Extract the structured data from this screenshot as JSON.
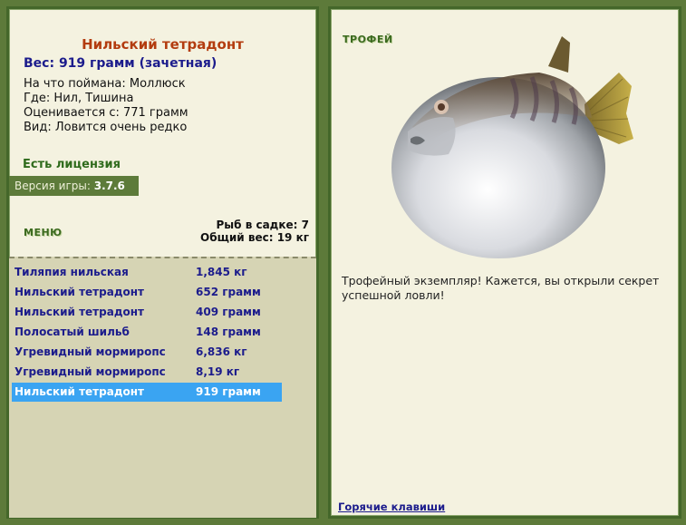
{
  "fish": {
    "title": "Нильский тетрадонт",
    "weight_line": "Вес: 919 грамм (зачетная)",
    "bait": "На что поймана: Моллюск",
    "location": "Где: Нил, Тишина",
    "value": "Оценивается с: 771 грамм",
    "species": "Вид: Ловится очень редко"
  },
  "license": "Есть лицензия",
  "version": {
    "label": "Версия игры:",
    "number": "3.7.6"
  },
  "menu_label": "МЕНЮ",
  "cage": {
    "count": "Рыб в садке: 7",
    "total": "Общий вес: 19 кг"
  },
  "catch_list": [
    {
      "name": "Тиляпия нильская",
      "weight": "1,845 кг"
    },
    {
      "name": "Нильский тетрадонт",
      "weight": "652 грамм"
    },
    {
      "name": "Нильский тетрадонт",
      "weight": "409 грамм"
    },
    {
      "name": "Полосатый шильб",
      "weight": "148 грамм"
    },
    {
      "name": "Угревидный мормиропс",
      "weight": "6,836 кг"
    },
    {
      "name": "Угревидный мормиропс",
      "weight": "8,19 кг"
    },
    {
      "name": "Нильский тетрадонт",
      "weight": "919 грамм"
    }
  ],
  "selected_index": 6,
  "trophy": {
    "label": "ТРОФЕЙ",
    "text": "Трофейный экземпляр! Кажется, вы открыли секрет успешной ловли!"
  },
  "hotkeys": "Горячие клавиши"
}
